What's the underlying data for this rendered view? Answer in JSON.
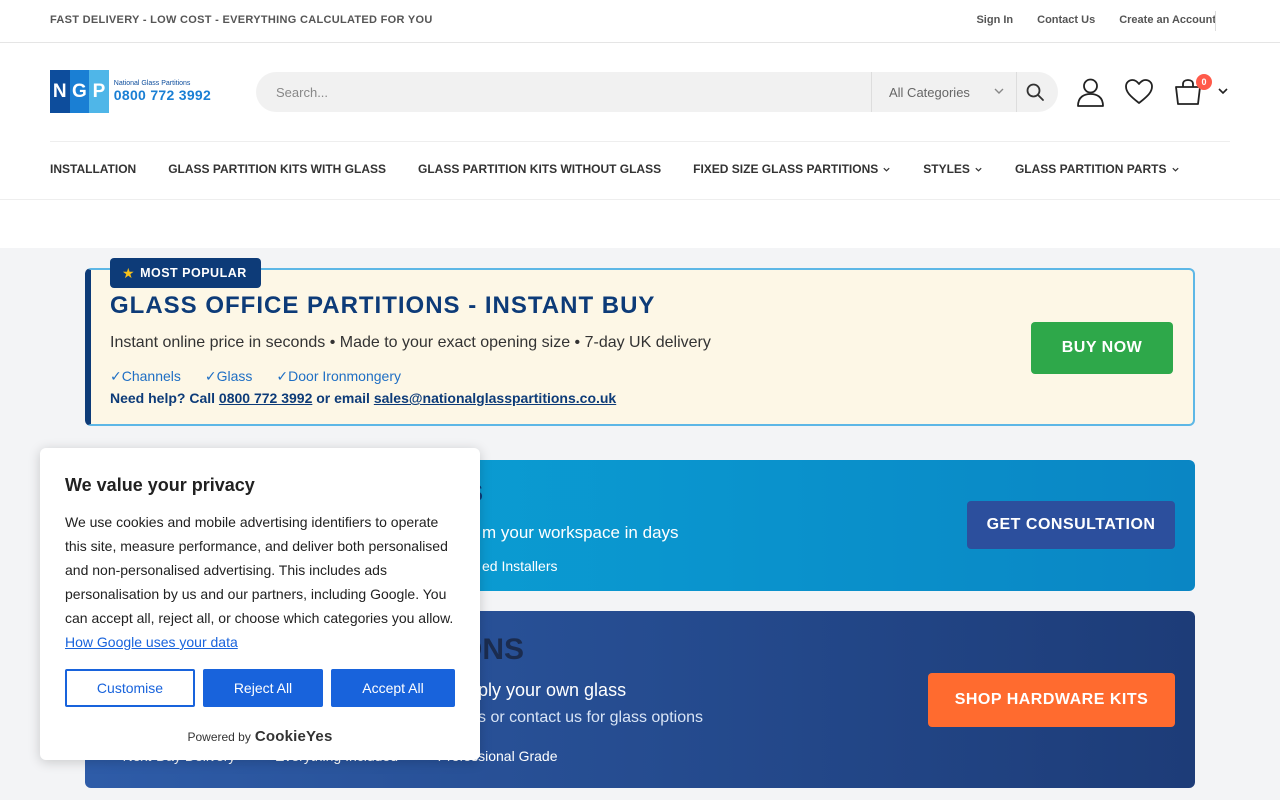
{
  "topbar": {
    "promo": "FAST DELIVERY - LOW COST - EVERYTHING CALCULATED FOR YOU",
    "links": [
      "Sign In",
      "Contact Us",
      "Create an Account"
    ]
  },
  "logo": {
    "letters": [
      "N",
      "G",
      "P"
    ],
    "name": "National Glass Partitions",
    "phone": "0800 772 3992"
  },
  "search": {
    "placeholder": "Search...",
    "category": "All Categories"
  },
  "cart": {
    "count": "0"
  },
  "nav": [
    {
      "label": "INSTALLATION",
      "dropdown": false
    },
    {
      "label": "GLASS PARTITION KITS WITH GLASS",
      "dropdown": false
    },
    {
      "label": "GLASS PARTITION KITS WITHOUT GLASS",
      "dropdown": false
    },
    {
      "label": "FIXED SIZE GLASS PARTITIONS",
      "dropdown": true
    },
    {
      "label": "STYLES",
      "dropdown": true
    },
    {
      "label": "GLASS PARTITION PARTS",
      "dropdown": true
    }
  ],
  "banner1": {
    "badge": "MOST POPULAR",
    "title": "GLASS OFFICE PARTITIONS - INSTANT BUY",
    "subtitle": "Instant online price in seconds • Made to your exact opening size • 7-day UK delivery",
    "checks": [
      "✓Channels",
      "✓Glass",
      "✓Door Ironmongery"
    ],
    "help_prefix": "Need help? Call ",
    "help_phone": "0800 772 3992",
    "help_mid": " or email ",
    "help_email": "sales@nationalglasspartitions.co.uk",
    "cta": "BUY NOW"
  },
  "banner2": {
    "title_visible": "S",
    "subtitle_visible": "m your workspace in days",
    "checks_visible": "ed Installers",
    "cta": "GET CONSULTATION"
  },
  "banner3": {
    "title_visible": "ONS",
    "subtitle_visible": "ply your own glass",
    "subtitle2_visible": "s or contact us for glass options",
    "checks": [
      "✓ Next-Day Delivery",
      "✓ Everything Included",
      "✓ Professional Grade"
    ],
    "cta": "SHOP HARDWARE KITS"
  },
  "cookie": {
    "title": "We value your privacy",
    "body": "We use cookies and mobile advertising identifiers to operate this site, measure performance, and deliver both personalised and non-personalised advertising. This includes ads personalisation by us and our partners, including Google. You can accept all, reject all, or choose which categories you allow. ",
    "link": "How Google uses your data",
    "customise": "Customise",
    "reject": "Reject All",
    "accept": "Accept All",
    "powered_by": "Powered by",
    "brand": "CookieYes"
  },
  "colors": {
    "navy": "#0d3b78",
    "green": "#2ea84a",
    "cyan": "#0ba6d9",
    "orange": "#ff6b2f",
    "cookie_blue": "#1863dc"
  }
}
